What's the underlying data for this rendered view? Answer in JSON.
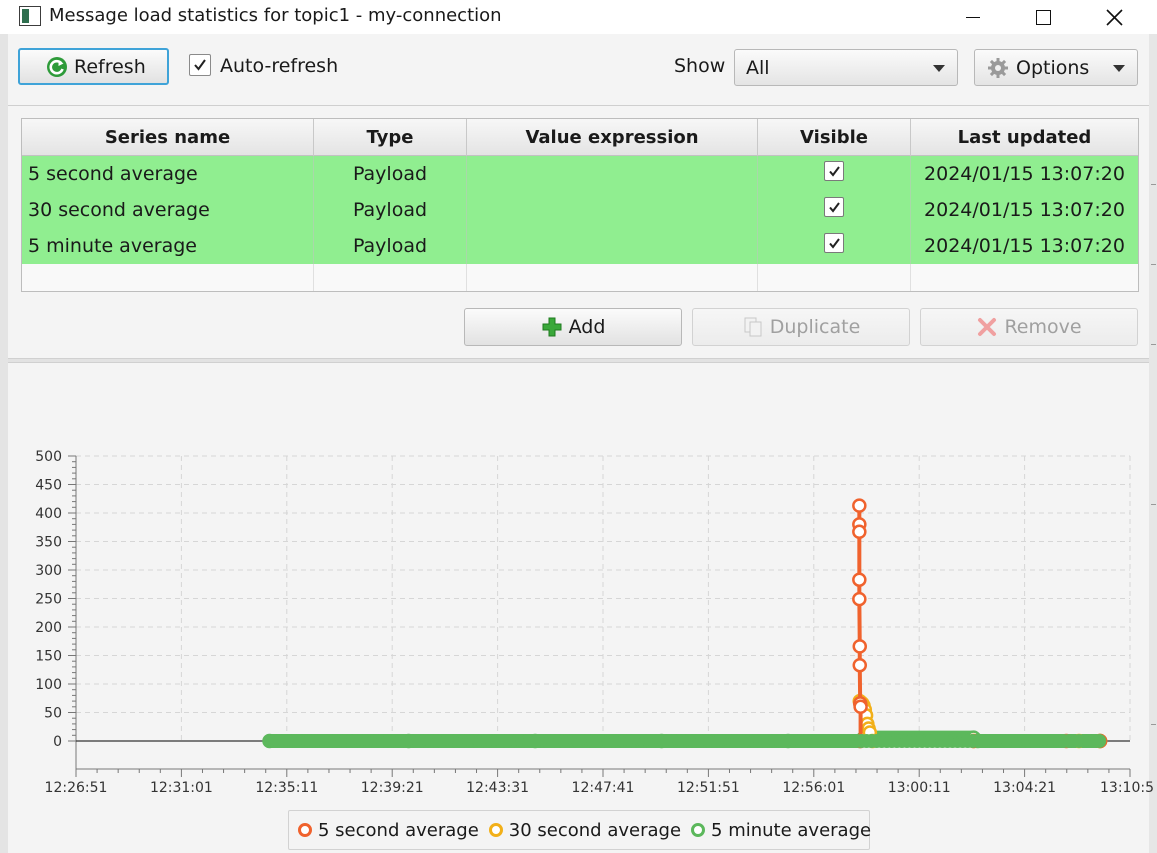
{
  "window": {
    "title": "Message load statistics for topic1 - my-connection"
  },
  "toolbar": {
    "refresh_label": "Refresh",
    "auto_refresh_label": "Auto-refresh",
    "auto_refresh_checked": true,
    "show_label": "Show",
    "show_selected": "All",
    "options_label": "Options"
  },
  "table": {
    "columns": [
      "Series name",
      "Type",
      "Value expression",
      "Visible",
      "Last updated"
    ],
    "rows": [
      {
        "name": "5 second average",
        "type": "Payload",
        "expression": "",
        "visible": true,
        "updated": "2024/01/15 13:07:20"
      },
      {
        "name": "30 second average",
        "type": "Payload",
        "expression": "",
        "visible": true,
        "updated": "2024/01/15 13:07:20"
      },
      {
        "name": "5 minute average",
        "type": "Payload",
        "expression": "",
        "visible": true,
        "updated": "2024/01/15 13:07:20"
      }
    ],
    "row_color": "#90ee90"
  },
  "actions": {
    "add_label": "Add",
    "duplicate_label": "Duplicate",
    "remove_label": "Remove"
  },
  "chart_data": {
    "type": "line",
    "title": "",
    "xlabel": "",
    "ylabel": "",
    "ylim": [
      0,
      500
    ],
    "yticks": [
      0,
      50,
      100,
      150,
      200,
      250,
      300,
      350,
      400,
      450,
      500
    ],
    "xticks": [
      "12:26:51",
      "12:31:01",
      "12:35:11",
      "12:39:21",
      "12:43:31",
      "12:47:41",
      "12:51:51",
      "12:56:01",
      "13:00:11",
      "13:04:21",
      "13:10:5"
    ],
    "grid": true,
    "legend": "bottom-center",
    "series": [
      {
        "name": "5 second average",
        "color": "#f0622d",
        "points": [
          {
            "x": "12:57:49",
            "y": 413
          },
          {
            "x": "12:57:49",
            "y": 380
          },
          {
            "x": "12:57:49",
            "y": 367
          },
          {
            "x": "12:57:49",
            "y": 283
          },
          {
            "x": "12:57:49",
            "y": 249
          },
          {
            "x": "12:57:50",
            "y": 166
          },
          {
            "x": "12:57:50",
            "y": 133
          },
          {
            "x": "12:57:51",
            "y": 66
          },
          {
            "x": "12:57:52",
            "y": 60
          },
          {
            "x": "12:57:52",
            "y": 0
          },
          {
            "x": "13:02:20",
            "y": 0
          },
          {
            "x": "13:06:00",
            "y": 0
          },
          {
            "x": "13:07:20",
            "y": 0
          }
        ]
      },
      {
        "name": "30 second average",
        "color": "#f2b019",
        "points": [
          {
            "x": "12:57:50",
            "y": 70
          },
          {
            "x": "12:57:53",
            "y": 68
          },
          {
            "x": "12:57:56",
            "y": 66
          },
          {
            "x": "12:57:59",
            "y": 62
          },
          {
            "x": "12:58:02",
            "y": 55
          },
          {
            "x": "12:58:05",
            "y": 45
          },
          {
            "x": "12:58:08",
            "y": 30
          },
          {
            "x": "12:58:11",
            "y": 22
          },
          {
            "x": "12:58:14",
            "y": 15
          },
          {
            "x": "12:58:20",
            "y": 0
          },
          {
            "x": "13:02:20",
            "y": 0
          },
          {
            "x": "13:06:30",
            "y": 0
          },
          {
            "x": "13:07:20",
            "y": 0
          }
        ]
      },
      {
        "name": "5 minute average",
        "color": "#5cb85c",
        "points": [
          {
            "x": "12:34:30",
            "y": 0
          },
          {
            "x": "12:40:00",
            "y": 0
          },
          {
            "x": "12:45:00",
            "y": 0
          },
          {
            "x": "12:50:00",
            "y": 0
          },
          {
            "x": "12:55:00",
            "y": 0
          },
          {
            "x": "12:57:50",
            "y": 0
          },
          {
            "x": "12:58:00",
            "y": 6
          },
          {
            "x": "13:02:20",
            "y": 6
          },
          {
            "x": "13:02:30",
            "y": 0
          },
          {
            "x": "13:07:20",
            "y": 0
          }
        ]
      }
    ]
  }
}
